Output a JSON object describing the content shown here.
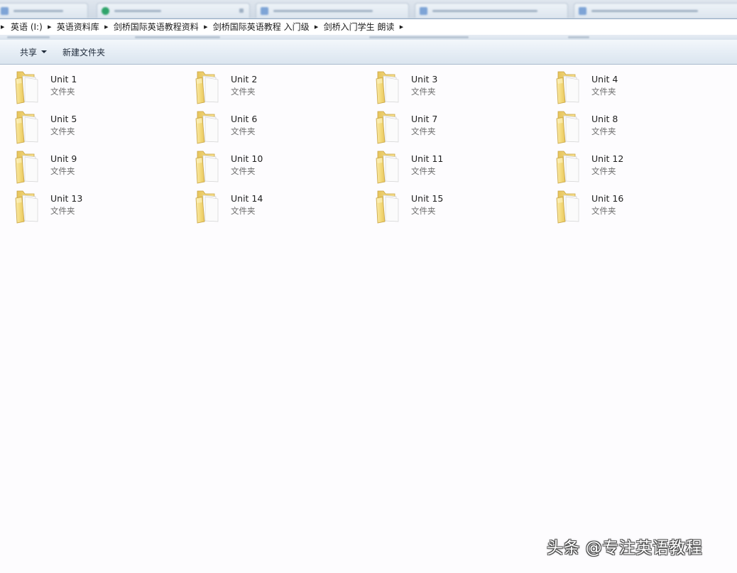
{
  "address_bar": {
    "breadcrumbs": [
      {
        "label": "英语 (I:)"
      },
      {
        "label": "英语资料库"
      },
      {
        "label": "剑桥国际英语教程资料"
      },
      {
        "label": "剑桥国际英语教程 入门级"
      },
      {
        "label": "剑桥入门学生 朗读"
      }
    ],
    "separator_icon": "chevron-right-icon"
  },
  "toolbar": {
    "share_label": "共享",
    "new_folder_label": "新建文件夹"
  },
  "folders": [
    {
      "name": "Unit 1",
      "type": "文件夹"
    },
    {
      "name": "Unit 2",
      "type": "文件夹"
    },
    {
      "name": "Unit 3",
      "type": "文件夹"
    },
    {
      "name": "Unit 4",
      "type": "文件夹"
    },
    {
      "name": "Unit 5",
      "type": "文件夹"
    },
    {
      "name": "Unit 6",
      "type": "文件夹"
    },
    {
      "name": "Unit 7",
      "type": "文件夹"
    },
    {
      "name": "Unit 8",
      "type": "文件夹"
    },
    {
      "name": "Unit 9",
      "type": "文件夹"
    },
    {
      "name": "Unit 10",
      "type": "文件夹"
    },
    {
      "name": "Unit 11",
      "type": "文件夹"
    },
    {
      "name": "Unit 12",
      "type": "文件夹"
    },
    {
      "name": "Unit 13",
      "type": "文件夹"
    },
    {
      "name": "Unit 14",
      "type": "文件夹"
    },
    {
      "name": "Unit 15",
      "type": "文件夹"
    },
    {
      "name": "Unit 16",
      "type": "文件夹"
    }
  ],
  "folder_icon": "folder-icon",
  "watermark": "头条 @专注英语教程",
  "colors": {
    "window_background": "#fdfcfe",
    "toolbar_gradient_top": "#f3f7fb",
    "toolbar_gradient_bottom": "#dbe5ef",
    "folder_yellow": "#f5dd8a",
    "type_text": "#6d6d6d"
  }
}
